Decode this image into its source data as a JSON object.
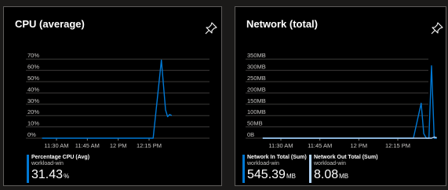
{
  "cpu_tile": {
    "title": "CPU (average)",
    "pin_icon": "pin-icon",
    "y_ticks": [
      "70%",
      "60%",
      "50%",
      "40%",
      "30%",
      "20%",
      "10%",
      "0%"
    ],
    "x_ticks": [
      "11:30 AM",
      "11:45 AM",
      "12 PM",
      "12:15 PM"
    ],
    "legend": [
      {
        "name": "Percentage CPU (Avg)",
        "resource": "workload-win",
        "value": "31.43",
        "unit": "%",
        "color": "#0078d4"
      }
    ]
  },
  "network_tile": {
    "title": "Network (total)",
    "pin_icon": "pin-icon",
    "y_ticks": [
      "350MB",
      "300MB",
      "250MB",
      "200MB",
      "150MB",
      "100MB",
      "50MB",
      "0B"
    ],
    "x_ticks": [
      "11:30 AM",
      "11:45 AM",
      "12 PM",
      "12:15 PM"
    ],
    "legend": [
      {
        "name": "Network In Total (Sum)",
        "resource": "workload-win",
        "value": "545.39",
        "unit": "MB",
        "color": "#0078d4"
      },
      {
        "name": "Network Out Total (Sum)",
        "resource": "workload-win",
        "value": "8.08",
        "unit": "MB",
        "color": "#b4d6fa"
      }
    ]
  },
  "chart_data": [
    {
      "type": "line",
      "title": "CPU (average)",
      "x_ticks": [
        "11:30 AM",
        "11:45 AM",
        "12 PM",
        "12:15 PM"
      ],
      "ylim": [
        0,
        75
      ],
      "y_unit": "%",
      "grid": true,
      "legend_position": "bottom-left",
      "series": [
        {
          "name": "Percentage CPU (Avg)",
          "color": "#0078d4",
          "points": [
            {
              "x": "11:23 AM",
              "y": 0
            },
            {
              "x": "12:17 PM",
              "y": 0
            },
            {
              "x": "12:21 PM",
              "y": 69
            },
            {
              "x": "12:23 PM",
              "y": 25
            },
            {
              "x": "12:24 PM",
              "y": 19
            },
            {
              "x": "12:25 PM",
              "y": 21
            },
            {
              "x": "12:26 PM",
              "y": 20
            }
          ]
        }
      ]
    },
    {
      "type": "line",
      "title": "Network (total)",
      "x_ticks": [
        "11:30 AM",
        "11:45 AM",
        "12 PM",
        "12:15 PM"
      ],
      "ylim": [
        0,
        375
      ],
      "y_unit": "MB",
      "grid": true,
      "legend_position": "bottom-left",
      "series": [
        {
          "name": "Network In Total (Sum)",
          "color": "#0078d4",
          "points": [
            {
              "x": "11:23 AM",
              "y": 0
            },
            {
              "x": "12:21 PM",
              "y": 0
            },
            {
              "x": "12:24 PM",
              "y": 155
            },
            {
              "x": "12:25 PM",
              "y": 20
            },
            {
              "x": "12:26 PM",
              "y": 0
            },
            {
              "x": "12:27 PM",
              "y": 0
            },
            {
              "x": "12:28 PM",
              "y": 320
            },
            {
              "x": "12:29 PM",
              "y": 0
            },
            {
              "x": "12:30 PM",
              "y": 0
            }
          ]
        },
        {
          "name": "Network Out Total (Sum)",
          "color": "#b4d6fa",
          "points": [
            {
              "x": "11:23 AM",
              "y": 0
            },
            {
              "x": "12:28 PM",
              "y": 0
            },
            {
              "x": "12:29 PM",
              "y": 5
            },
            {
              "x": "12:30 PM",
              "y": 2
            }
          ]
        }
      ]
    }
  ]
}
